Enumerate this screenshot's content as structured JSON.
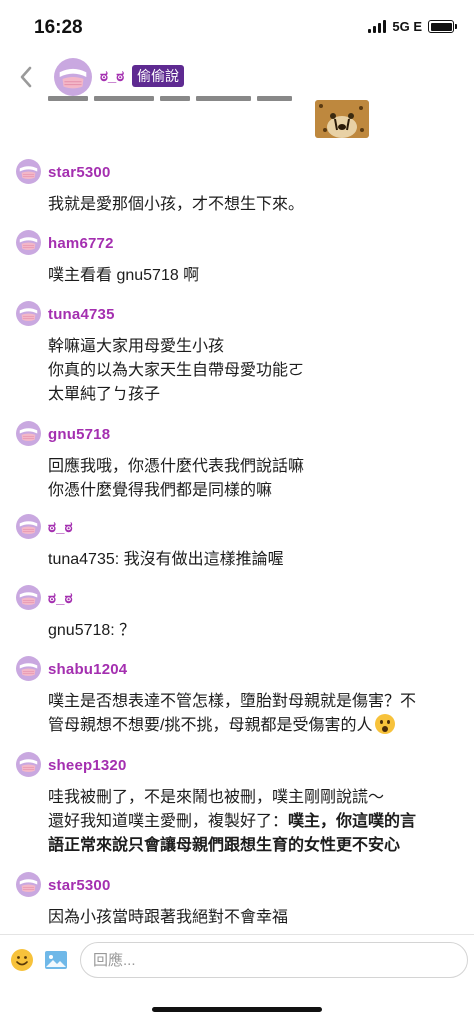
{
  "status": {
    "time": "16:28",
    "network": "5G E"
  },
  "header": {
    "title": "ಠ_ಠ",
    "badge": "偷偷說"
  },
  "messages": [
    {
      "user": "star5300",
      "lines": [
        "我就是愛那個小孩，才不想生下來。"
      ]
    },
    {
      "user": "ham6772",
      "lines": [
        "噗主看看 gnu5718 啊"
      ]
    },
    {
      "user": "tuna4735",
      "lines": [
        "幹嘛逼大家用母愛生小孩",
        "你真的以為大家天生自帶母愛功能ㄛ",
        "太單純了ㄅ孩子"
      ]
    },
    {
      "user": "gnu5718",
      "lines": [
        "回應我哦，你憑什麼代表我們說話嘛",
        "你憑什麼覺得我們都是同樣的嘛"
      ]
    },
    {
      "user": "ಠ_ಠ",
      "lines": [
        "tuna4735: 我沒有做出這樣推論喔"
      ]
    },
    {
      "user": "ಠ_ಠ",
      "lines": [
        "gnu5718: ？"
      ]
    },
    {
      "user": "shabu1204",
      "lines": [
        "噗主是否想表達不管怎樣，墮胎對母親就是傷害？不",
        "管母親想不想要/挑不挑，母親都是受傷害的人"
      ]
    },
    {
      "user": "sheep1320",
      "lines": [
        "哇我被刪了，不是來鬧也被刪，噗主剛剛說謊～",
        "還好我知道噗主愛刪，複製好了：",
        "語正常來說只會讓母親們跟想生育的女性更不安心"
      ],
      "bold_tail": "噗主，你這噗的言"
    },
    {
      "user": "star5300",
      "lines": [
        "因為小孩當時跟著我絕對不會幸福"
      ]
    }
  ],
  "reply": {
    "placeholder": "回應..."
  },
  "icons": {
    "back": "chevron-left-icon",
    "emoji": "smiley-icon",
    "image": "image-icon"
  },
  "colors": {
    "username": "#a42fb0",
    "badge_bg": "#5e2a91",
    "avatar_bg": "#c9a8e0",
    "avatar_mask": "#f3b7c8"
  }
}
